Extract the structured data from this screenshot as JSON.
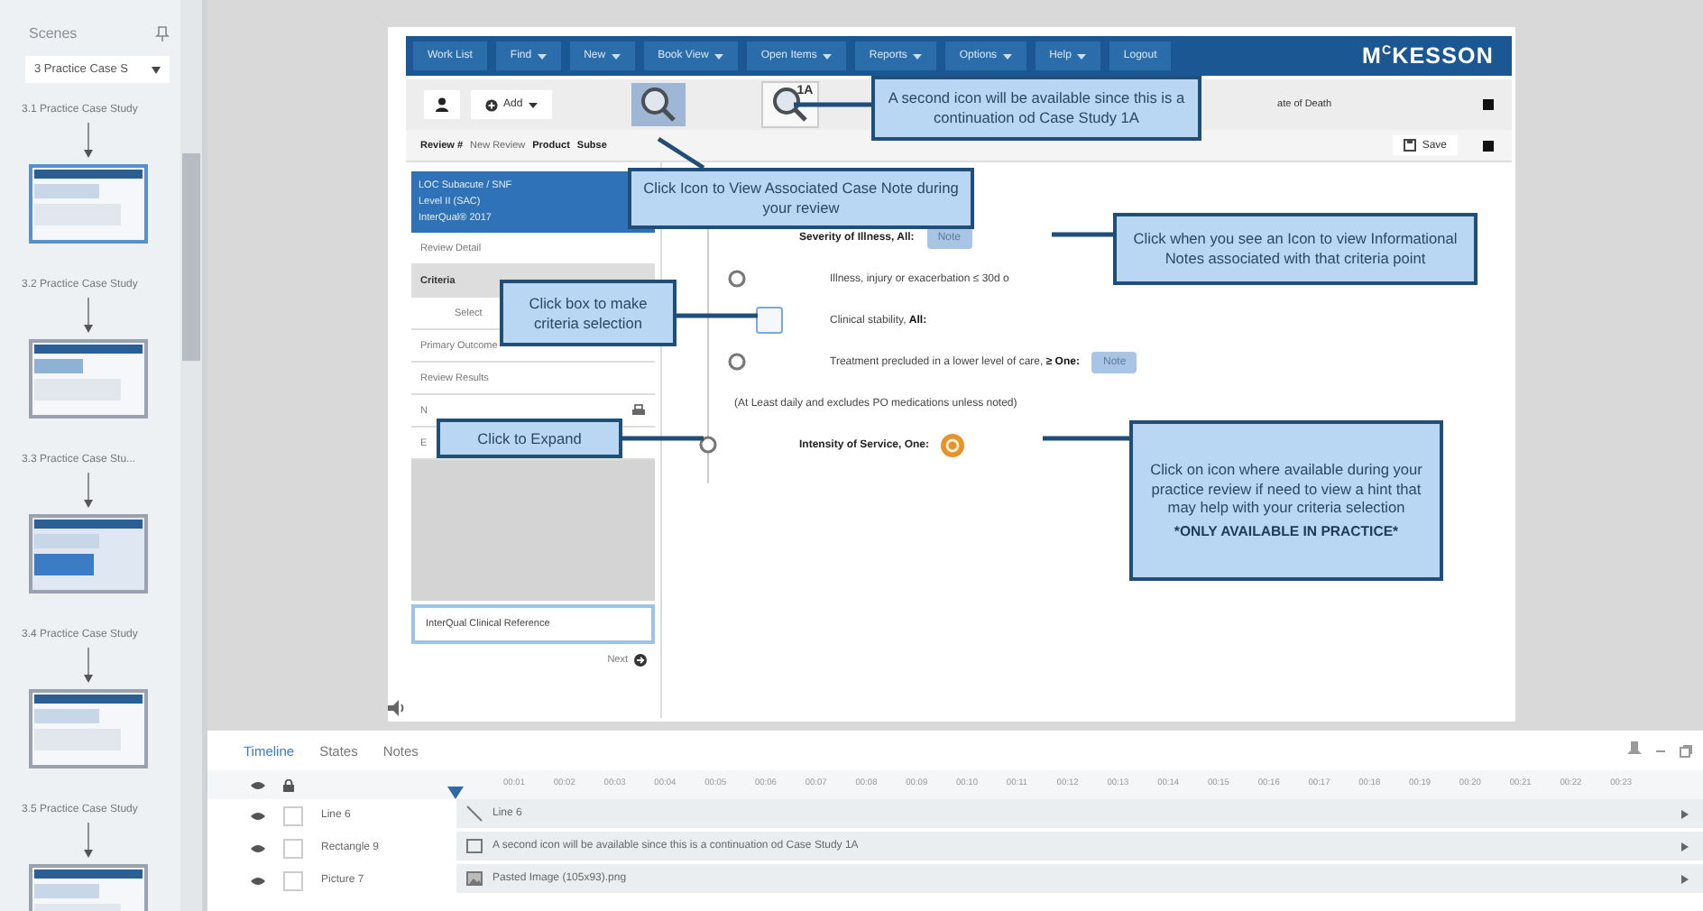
{
  "scenes_panel": {
    "title": "Scenes",
    "scene_select": "3 Practice Case S",
    "scenes": [
      {
        "label": "3.1 Practice Case Study",
        "selected": true
      },
      {
        "label": "3.2 Practice Case Study",
        "selected": false
      },
      {
        "label": "3.3 Practice Case Stu...",
        "selected": false
      },
      {
        "label": "3.4 Practice Case Study",
        "selected": false
      },
      {
        "label": "3.5 Practice Case Study",
        "selected": false
      }
    ]
  },
  "slide": {
    "nav": {
      "items": [
        {
          "label": "Work List",
          "dropdown": false
        },
        {
          "label": "Find",
          "dropdown": true
        },
        {
          "label": "New",
          "dropdown": true
        },
        {
          "label": "Book View",
          "dropdown": true
        },
        {
          "label": "Open Items",
          "dropdown": true
        },
        {
          "label": "Reports",
          "dropdown": true
        },
        {
          "label": "Options",
          "dropdown": true
        },
        {
          "label": "Help",
          "dropdown": true
        },
        {
          "label": "Logout",
          "dropdown": false
        }
      ],
      "logo": "M$^{C}$KESSON"
    },
    "toolbar": {
      "add_label": "Add",
      "case_note_icons": [
        {
          "highlighted": true
        },
        {
          "label": "1A",
          "highlighted": false
        }
      ],
      "field_text": "ate of Death"
    },
    "review_bar": {
      "items": [
        {
          "text": "Review #",
          "kind": "label"
        },
        {
          "text": "New Review",
          "kind": "value"
        },
        {
          "text": "Product",
          "kind": "label"
        },
        {
          "text": "Subse",
          "kind": "label"
        }
      ],
      "save_label": "Save"
    },
    "side_nav": {
      "header": [
        "LOC Subacute / SNF",
        "Level II (SAC)",
        "InterQual® 2017"
      ],
      "items": [
        {
          "label": "Review Detail",
          "selected": false,
          "kind": "item"
        },
        {
          "label": "Criteria",
          "selected": true,
          "kind": "item"
        },
        {
          "label": "Select",
          "selected": false,
          "kind": "subitem"
        },
        {
          "label": "Primary Outcome",
          "selected": false,
          "kind": "item"
        },
        {
          "label": "Review Results",
          "selected": false,
          "kind": "item"
        },
        {
          "label": "N",
          "selected": false,
          "kind": "print"
        },
        {
          "label": "E",
          "selected": false,
          "kind": "item"
        }
      ],
      "reference_label": "InterQual Clinical Reference",
      "next_label": "Next"
    },
    "criteria": [
      {
        "kind": "group",
        "text": "Severity of Illness, All:",
        "note": "Note"
      },
      {
        "kind": "point",
        "node": true,
        "text": "Illness, injury or exacerbation ≤ 30d o"
      },
      {
        "kind": "point",
        "checked": false,
        "text": "Clinical stability, **All:**"
      },
      {
        "kind": "point",
        "node": true,
        "text": "Treatment precluded in a lower level of care, **≥ One:**",
        "note": "Note"
      },
      {
        "kind": "remark",
        "text": "(At Least daily and excludes PO medications unless noted)"
      },
      {
        "kind": "group",
        "node": true,
        "text": "Intensity of Service, One:",
        "hint": true
      }
    ],
    "callouts": [
      {
        "text": "A second icon will be available since this is a continuation od Case Study 1A"
      },
      {
        "text": "Click Icon to View Associated Case Note during your review"
      },
      {
        "text": "Click when you see an Icon to view Informational Notes associated with that criteria point"
      },
      {
        "text": "Click box to make criteria selection"
      },
      {
        "text": "Click to Expand"
      },
      {
        "text": "Click on icon where available during your practice review if need to view a hint that may help with your criteria selection",
        "emphasis": "*ONLY AVAILABLE IN PRACTICE*"
      }
    ]
  },
  "timeline": {
    "tabs": [
      {
        "label": "Timeline",
        "selected": true
      },
      {
        "label": "States",
        "selected": false
      },
      {
        "label": "Notes",
        "selected": false
      }
    ],
    "ticks": [
      "00:01",
      "00:02",
      "00:03",
      "00:04",
      "00:05",
      "00:06",
      "00:07",
      "00:08",
      "00:09",
      "00:10",
      "00:11",
      "00:12",
      "00:13",
      "00:14",
      "00:15",
      "00:16",
      "00:17",
      "00:18",
      "00:19",
      "00:20",
      "00:21",
      "00:22",
      "00:23"
    ],
    "rows": [
      {
        "name": "Line 6",
        "kind": "line",
        "locked": false,
        "track": "Line 6"
      },
      {
        "name": "Rectangle 9",
        "kind": "shape",
        "locked": false,
        "track": "A second icon will be available since this is a continuation od Case Study 1A"
      },
      {
        "name": "Picture 7",
        "kind": "image",
        "locked": false,
        "track": "Pasted Image (105x93).png"
      }
    ]
  }
}
